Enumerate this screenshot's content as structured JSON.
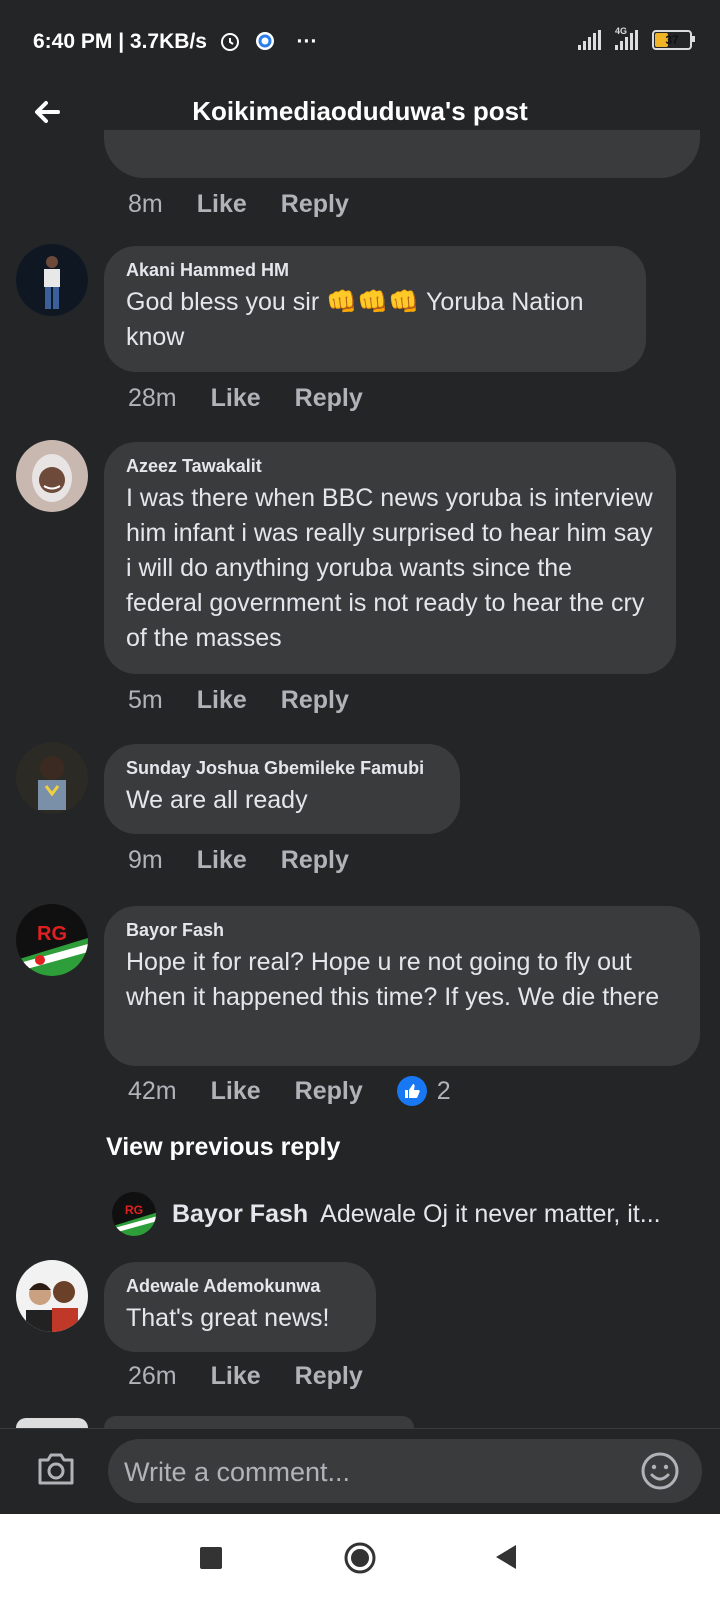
{
  "status": {
    "time": "6:40 PM",
    "speed": "3.7KB/s",
    "more": "···",
    "network": "4G",
    "battery": "37"
  },
  "header": {
    "title": "Koikimediaoduduwa's post"
  },
  "actions": {
    "like": "Like",
    "reply": "Reply"
  },
  "comments": [
    {
      "time": "8m"
    },
    {
      "author": "Akani Hammed HM",
      "text": "God bless you sir 👊👊👊 Yoruba Nation know",
      "time": "28m"
    },
    {
      "author": "Azeez Tawakalit",
      "text": "I was there when BBC news yoruba is interview him infant i was really surprised to hear him say i will do anything yoruba wants since the federal government is not ready to hear the cry of the masses",
      "time": "5m"
    },
    {
      "author": "Sunday Joshua Gbemileke Famubi",
      "text": "We are all ready",
      "time": "9m"
    },
    {
      "author": "Bayor Fash",
      "text": "Hope it for real?  Hope u re not going to fly out when it happened this time?  If yes. We die there",
      "time": "42m",
      "reactions": "2"
    },
    {
      "author": "Adewale Ademokunwa",
      "text": "That's great news!",
      "time": "26m"
    }
  ],
  "view_previous": "View previous reply",
  "reply_preview": {
    "author": "Bayor Fash",
    "text": "Adewale Oj it never matter, it..."
  },
  "composer": {
    "placeholder": "Write a comment..."
  },
  "avatar_badge": "RG",
  "colors": {
    "background": "#242526",
    "bubble": "#3a3b3c",
    "like_blue": "#1877f2",
    "muted": "#b0b3b8"
  }
}
